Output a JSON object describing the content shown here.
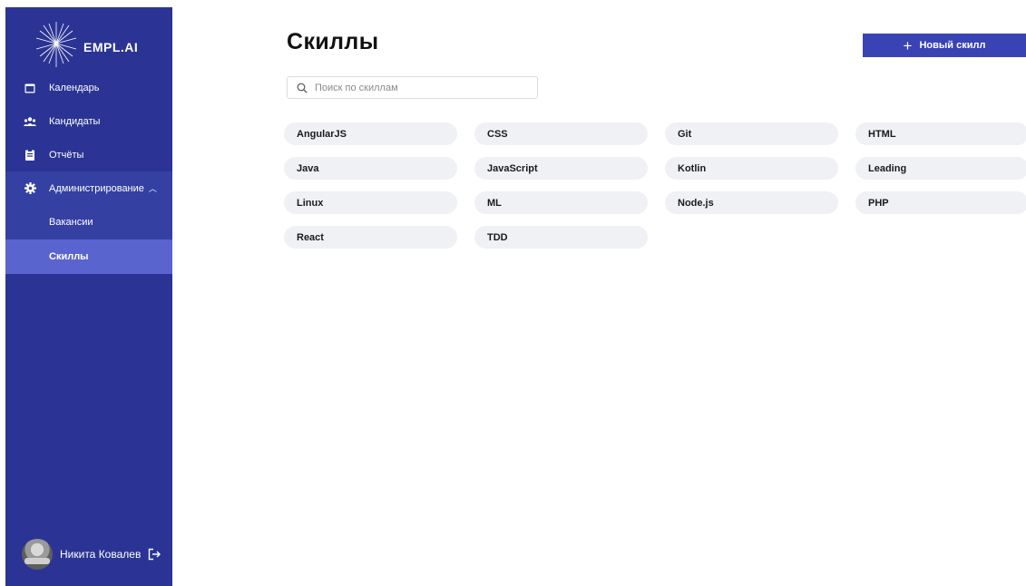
{
  "brand": {
    "name": "EMPL.AI"
  },
  "sidebar": {
    "items": [
      {
        "label": "Календарь",
        "icon": "calendar-icon"
      },
      {
        "label": "Кандидаты",
        "icon": "users-icon"
      },
      {
        "label": "Отчёты",
        "icon": "report-icon"
      },
      {
        "label": "Администрирование",
        "icon": "gear-icon",
        "expanded": true
      }
    ],
    "subitems": [
      {
        "label": "Вакансии",
        "active": false
      },
      {
        "label": "Скиллы",
        "active": true
      }
    ]
  },
  "user": {
    "name": "Никита Ковалев"
  },
  "main": {
    "title": "Скиллы",
    "new_button_label": "Новый скилл",
    "search_placeholder": "Поиск по скиллам",
    "skills": [
      "AngularJS",
      "CSS",
      "Git",
      "HTML",
      "Java",
      "JavaScript",
      "Kotlin",
      "Leading",
      "Linux",
      "ML",
      "Node.js",
      "PHP",
      "React",
      "TDD"
    ]
  },
  "colors": {
    "sidebar_bg": "#2b3494",
    "active_bg": "#5964cf",
    "accent": "#3a43b3",
    "chip_bg": "#f0f1f5"
  }
}
